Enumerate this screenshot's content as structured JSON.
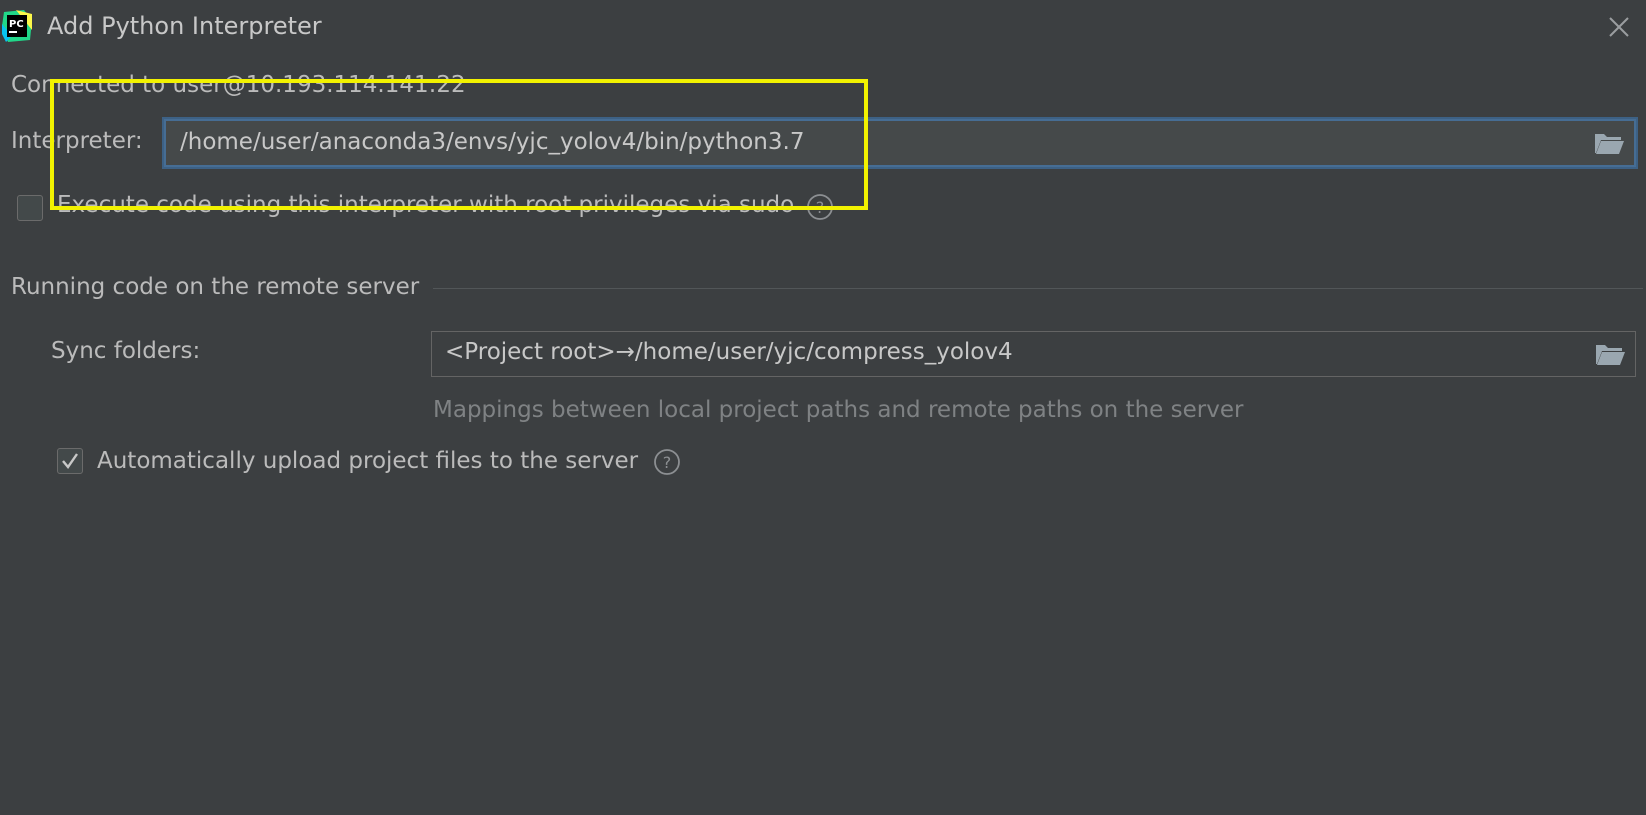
{
  "window": {
    "title": "Add Python Interpreter",
    "app_icon": "pycharm-logo",
    "app_icon_text": "PC",
    "close_icon": "close-icon"
  },
  "connection": {
    "status_text": "Connected to user@10.193.114.141:22"
  },
  "interpreter": {
    "label": "Interpreter:",
    "value": "/home/user/anaconda3/envs/yjc_yolov4/bin/python3.7",
    "browse_icon": "folder-open-icon"
  },
  "sudo": {
    "label": "Execute code using this interpreter with root privileges via sudo",
    "checked": false,
    "help_icon": "help-icon"
  },
  "remote_section": {
    "title": "Running code on the remote server",
    "sync_label": "Sync folders:",
    "sync_value": "<Project root>→/home/user/yjc/compress_yolov4",
    "sync_hint": "Mappings between local project paths and remote paths on the server",
    "upload_label": "Automatically upload project files to the server",
    "upload_checked": true
  },
  "colors": {
    "background": "#3c3f41",
    "field_focus_border": "#466d94",
    "highlight_annotation": "#f2f200",
    "text": "#bbbbbb",
    "hint_text": "#7f8284"
  }
}
